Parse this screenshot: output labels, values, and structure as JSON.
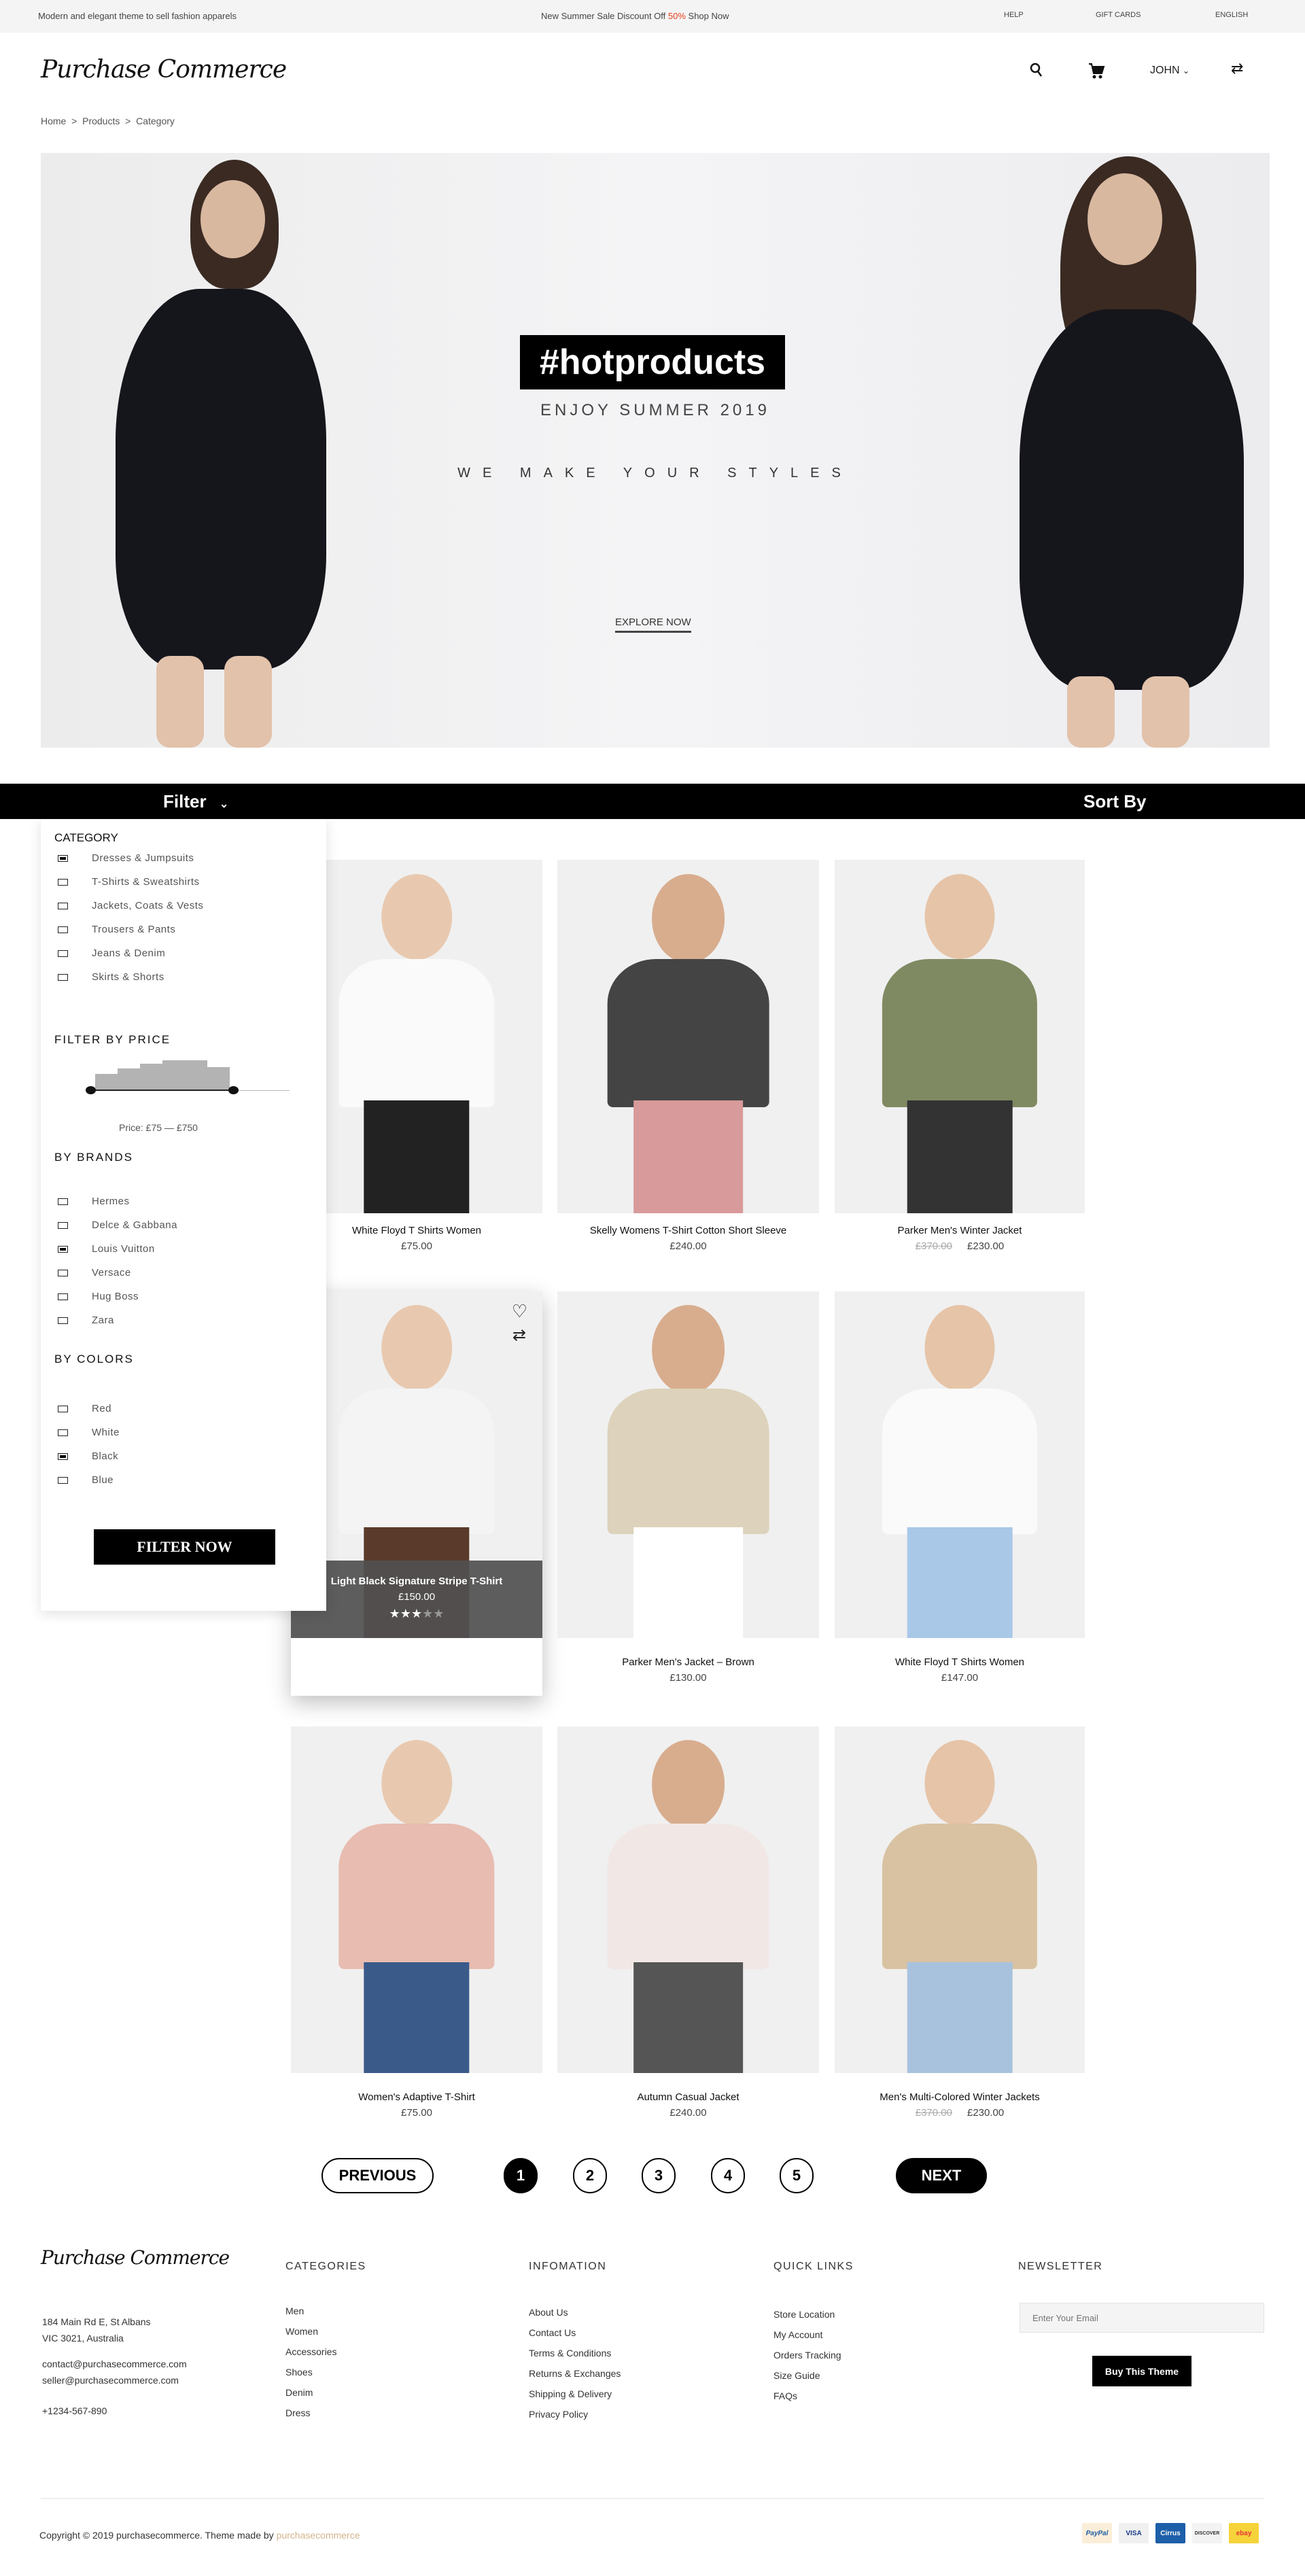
{
  "topbar": {
    "tagline": "Modern and elegant theme to sell fashion apparels",
    "promo_prefix": "New  Summer Sale Discount Off ",
    "promo_highlight": "50%",
    "promo_suffix": " Shop Now",
    "help": "HELP",
    "gift_cards": "GIFT CARDS",
    "language": "ENGLISH"
  },
  "header": {
    "logo": "Purchase Commerce",
    "user": "JOHN",
    "icons": [
      "search-icon",
      "cart-icon",
      "chevron-down-icon",
      "swap-icon"
    ]
  },
  "breadcrumb": [
    "Home",
    "Products",
    "Category"
  ],
  "breadcrumb_sep": ">",
  "hero": {
    "tag": "#hotproducts",
    "subtitle": "ENJOY SUMMER 2019",
    "tagline": "WE MAKE YOUR STYLES",
    "cta": "EXPLORE NOW"
  },
  "filterbar": {
    "filter": "Filter",
    "sort": "Sort By"
  },
  "sidebar": {
    "category_title": "CATEGORY",
    "categories": [
      {
        "label": "Dresses & Jumpsuits",
        "checked": true
      },
      {
        "label": "T-Shirts & Sweatshirts",
        "checked": false
      },
      {
        "label": "Jackets, Coats & Vests",
        "checked": false
      },
      {
        "label": "Trousers & Pants",
        "checked": false
      },
      {
        "label": "Jeans & Denim",
        "checked": false
      },
      {
        "label": "Skirts & Shorts",
        "checked": false
      }
    ],
    "price_title": "FILTER BY PRICE",
    "price_label": "Price: £75 — £750",
    "price_min": 75,
    "price_max": 750,
    "brands_title": "BY BRANDS",
    "brands": [
      {
        "label": "Hermes",
        "checked": false
      },
      {
        "label": "Delce & Gabbana",
        "checked": false
      },
      {
        "label": "Louis Vuitton",
        "checked": true
      },
      {
        "label": "Versace",
        "checked": false
      },
      {
        "label": "Hug Boss",
        "checked": false
      },
      {
        "label": "Zara",
        "checked": false
      }
    ],
    "colors_title": "BY COLORS",
    "colors": [
      {
        "label": "Red",
        "checked": false
      },
      {
        "label": "White",
        "checked": false
      },
      {
        "label": "Black",
        "checked": true
      },
      {
        "label": "Blue",
        "checked": false
      }
    ],
    "button": "FILTER NOW"
  },
  "products": [
    {
      "title": "White Floyd T Shirts Women",
      "price": "£75.00",
      "old": ""
    },
    {
      "title": "Skelly Womens T-Shirt Cotton Short Sleeve",
      "price": "£240.00",
      "old": ""
    },
    {
      "title": "Parker Men's Winter Jacket",
      "price": "£230.00",
      "old": "£370.00"
    },
    {
      "title": "Light Black Signature Stripe T-Shirt",
      "price": "£150.00",
      "old": "",
      "hover": true,
      "rating": 3,
      "rating_max": 5
    },
    {
      "title": "Parker Men's Jacket – Brown",
      "price": "£130.00",
      "old": ""
    },
    {
      "title": "White Floyd T Shirts Women",
      "price": "£147.00",
      "old": ""
    },
    {
      "title": "Women's Adaptive T-Shirt",
      "price": "£75.00",
      "old": ""
    },
    {
      "title": "Autumn Casual Jacket",
      "price": "£240.00",
      "old": ""
    },
    {
      "title": "Men's Multi-Colored Winter Jackets",
      "price": "£230.00",
      "old": "£370.00"
    }
  ],
  "pagination": {
    "previous": "PREVIOUS",
    "pages": [
      "1",
      "2",
      "3",
      "4",
      "5"
    ],
    "current": "1",
    "next": "NEXT"
  },
  "footer": {
    "logo": "Purchase Commerce",
    "address": [
      "184 Main Rd E, St Albans",
      "VIC 3021, Australia"
    ],
    "emails": [
      "contact@purchasecommerce.com",
      "seller@purchasecommerce.com"
    ],
    "phone": "+1234-567-890",
    "categories_title": "CATEGORIES",
    "categories": [
      "Men",
      "Women",
      "Accessories",
      "Shoes",
      "Denim",
      "Dress"
    ],
    "info_title": "INFOMATION",
    "info": [
      "About Us",
      "Contact Us",
      "Terms & Conditions",
      "Returns & Exchanges",
      "Shipping & Delivery",
      "Privacy Policy"
    ],
    "quick_title": "QUICK LINKS",
    "quick": [
      "Store Location",
      "My Account",
      "Orders Tracking",
      "Size Guide",
      "FAQs"
    ],
    "newsletter_title": "NEWSLETTER",
    "email_placeholder": "Enter Your Email",
    "buy": "Buy This Theme",
    "copyright": "Copyright © 2019 purchasecommerce. Theme made by ",
    "copyright_link": "purchasecommerce",
    "payments": [
      "PayPal",
      "VISA",
      "Cirrus",
      "DISCOVER",
      "ebay"
    ]
  },
  "colors": {
    "accent": "#e8401c",
    "link": "#d4b48a",
    "black": "#000000"
  }
}
